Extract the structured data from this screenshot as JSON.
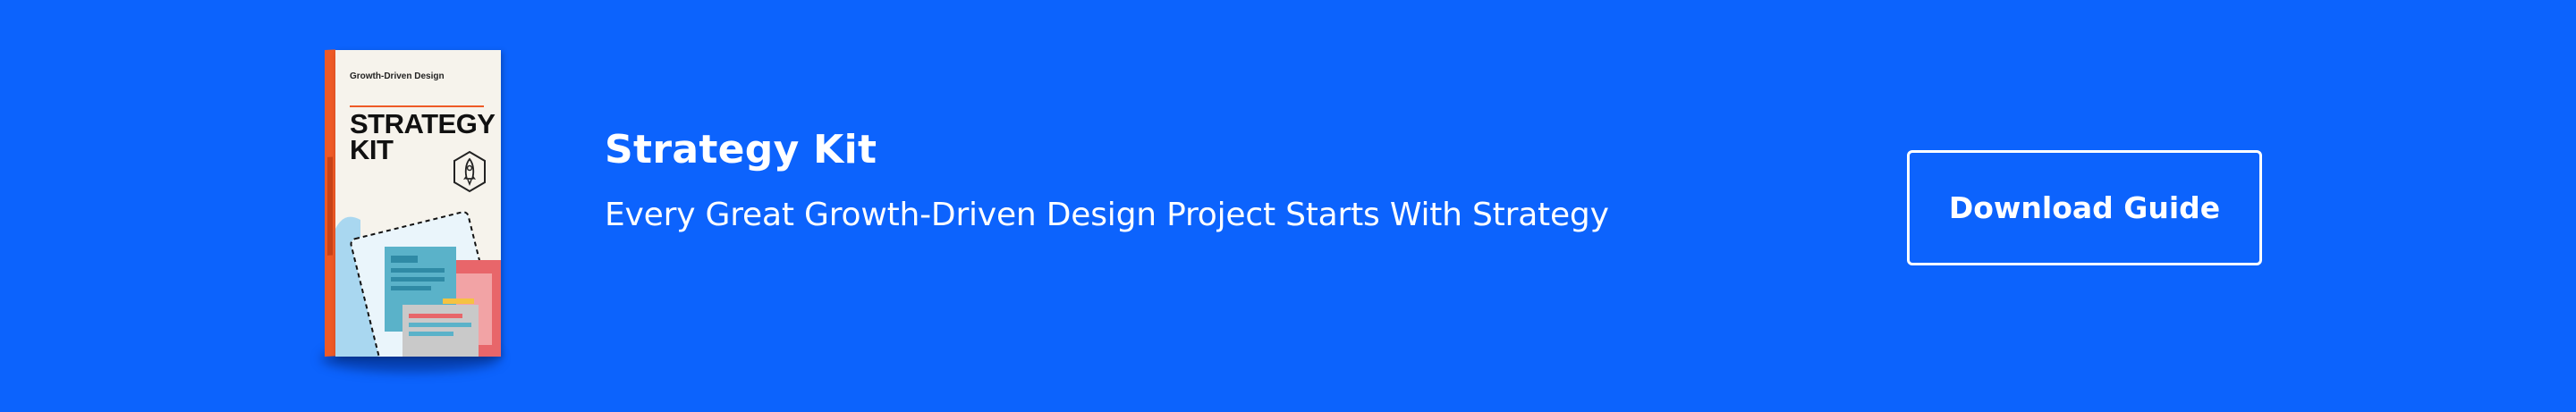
{
  "banner": {
    "background_color": "#0c63fd",
    "title": "Strategy Kit",
    "subtitle": "Every Great Growth-Driven Design Project Starts With Strategy",
    "cta_label": "Download Guide"
  },
  "book": {
    "kicker": "Growth-Driven Design",
    "title": "STRATEGY\nKIT",
    "spine_color": "#ee5a26",
    "badge_icon": "rocket-icon"
  }
}
